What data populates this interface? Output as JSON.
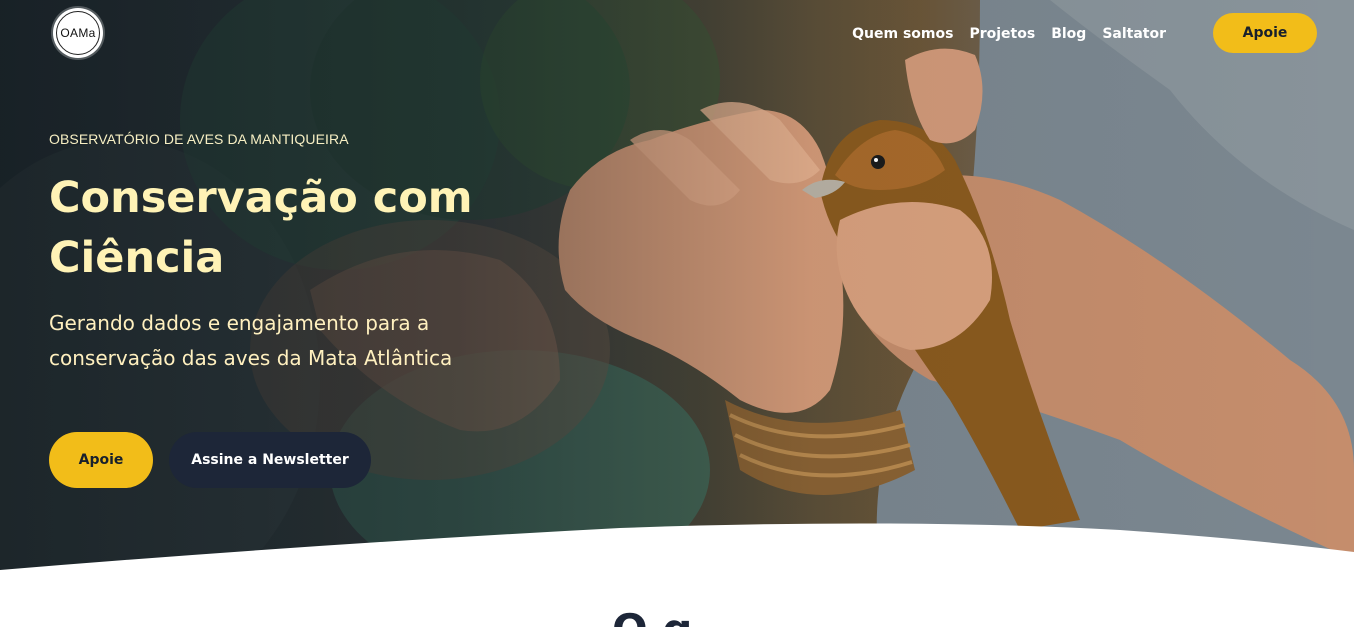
{
  "header": {
    "logo_text": "OAMa",
    "nav": [
      {
        "label": "Quem somos"
      },
      {
        "label": "Projetos"
      },
      {
        "label": "Blog"
      },
      {
        "label": "Saltator"
      }
    ],
    "cta_label": "Apoie"
  },
  "hero": {
    "eyebrow": "OBSERVATÓRIO DE AVES DA MANTIQUEIRA",
    "title_line1": "Conservação com",
    "title_line2": "Ciência",
    "subtitle_line1": "Gerando dados e engajamento para a",
    "subtitle_line2": "conservação das aves da Mata Atlântica",
    "primary_button": "Apoie",
    "secondary_button": "Assine a Newsletter",
    "image_subject": "hands-holding-bird-photo"
  },
  "next_section": {
    "heading_partial": "O q"
  },
  "colors": {
    "accent_yellow": "#f2bd19",
    "navy": "#1d2638",
    "headline_cream": "#fff3b6",
    "white": "#ffffff"
  }
}
